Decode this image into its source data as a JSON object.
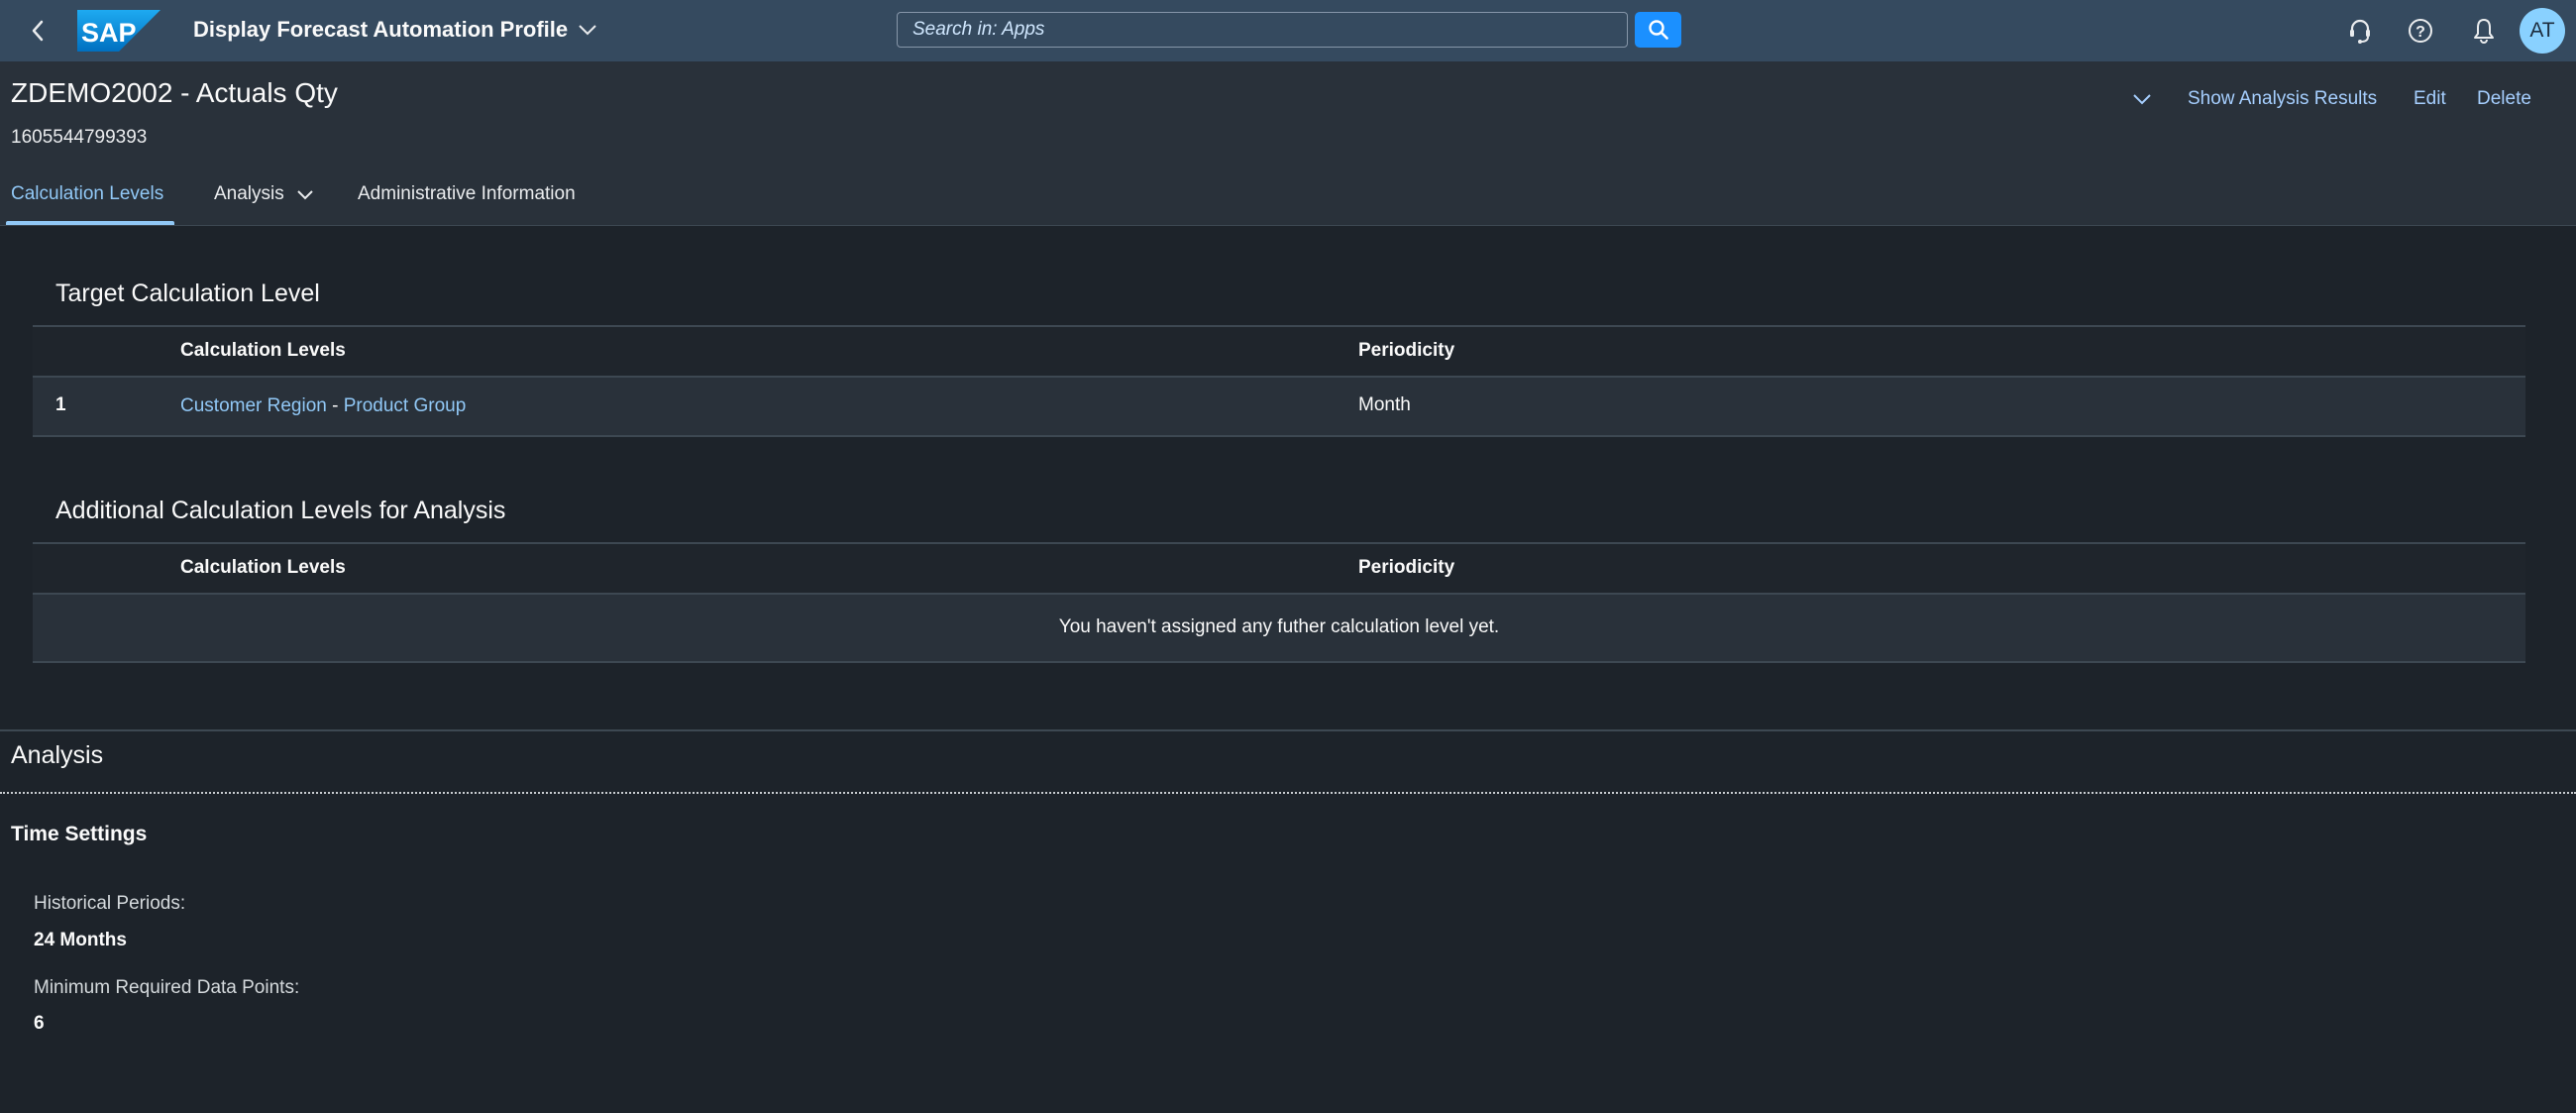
{
  "shell": {
    "app_title": "Display Forecast Automation Profile",
    "logo_text": "SAP",
    "search_placeholder": "Search in: Apps",
    "avatar_initials": "AT",
    "icons": [
      "back-icon",
      "chevron-down-icon",
      "search-icon",
      "headset-icon",
      "help-icon",
      "bell-icon"
    ],
    "colors": {
      "shell_bg": "#354a5f",
      "search_button": "#1b90ff",
      "avatar_bg": "#89d1ff",
      "logo_blue": "#1a8fd6"
    }
  },
  "object_header": {
    "title": "ZDEMO2002 - Actuals Qty",
    "subtitle": "1605544799393",
    "actions": {
      "show_analysis_results": "Show Analysis Results",
      "edit": "Edit",
      "delete": "Delete"
    }
  },
  "tabs": [
    {
      "label": "Calculation Levels",
      "active": true
    },
    {
      "label": "Analysis",
      "active": false,
      "has_dropdown": true
    },
    {
      "label": "Administrative Information",
      "active": false
    }
  ],
  "target_section": {
    "title": "Target Calculation Level",
    "columns": [
      "",
      "Calculation Levels",
      "Periodicity"
    ],
    "rows": [
      {
        "index": "1",
        "level_part1": "Customer Region",
        "separator": "-",
        "level_part2": "Product Group",
        "periodicity": "Month"
      }
    ]
  },
  "additional_section": {
    "title": "Additional Calculation Levels for Analysis",
    "columns": [
      "",
      "Calculation Levels",
      "Periodicity"
    ],
    "empty_text": "You haven't assigned any futher calculation level yet."
  },
  "analysis_section": {
    "title": "Analysis",
    "subsection_title": "Time Settings",
    "fields": [
      {
        "label": "Historical Periods:",
        "value": "24 Months"
      },
      {
        "label": "Minimum Required Data Points:",
        "value": "6"
      }
    ]
  },
  "colors": {
    "accent_link": "#91c8f6",
    "page_bg": "#1d232a",
    "header_bg": "#29313a"
  }
}
